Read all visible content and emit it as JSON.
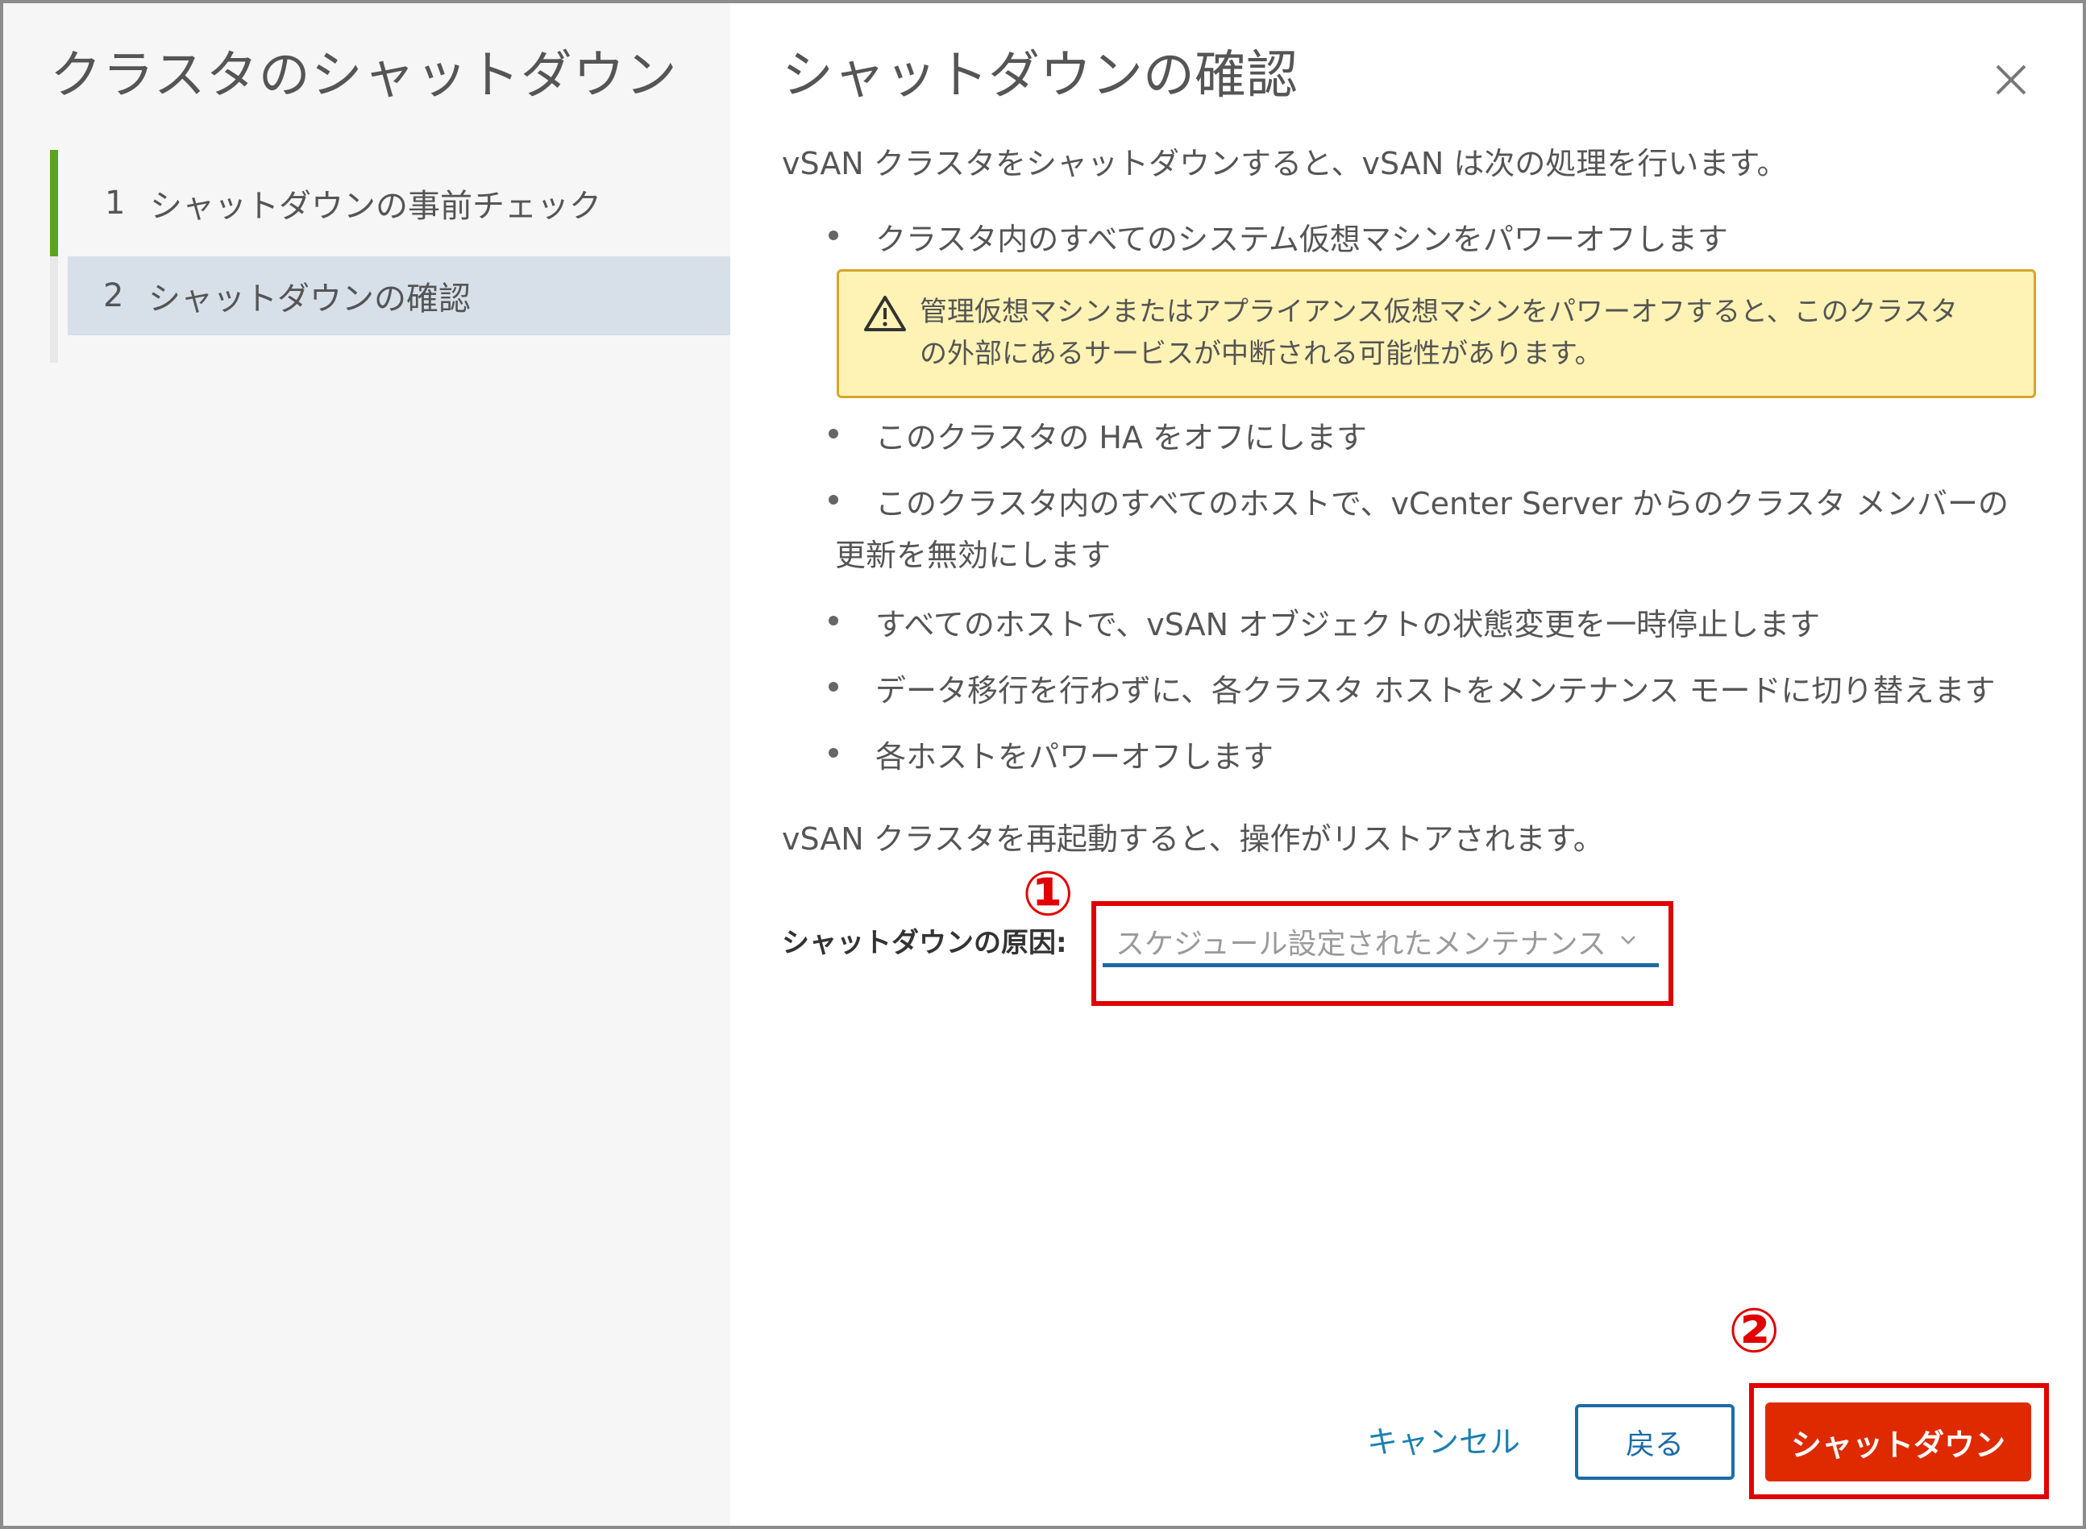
{
  "sidebar": {
    "title": "クラスタのシャットダウン",
    "steps": [
      {
        "num": "1",
        "label": "シャットダウンの事前チェック"
      },
      {
        "num": "2",
        "label": "シャットダウンの確認"
      }
    ]
  },
  "main": {
    "title": "シャットダウンの確認",
    "intro": "vSAN クラスタをシャットダウンすると、vSAN は次の処理を行います。",
    "bullets": [
      "クラスタ内のすべてのシステム仮想マシンをパワーオフします",
      "このクラスタの HA をオフにします",
      "このクラスタ内のすべてのホストで、vCenter Server からのクラスタ メンバーの",
      "すべてのホストで、vSAN オブジェクトの状態変更を一時停止します",
      "データ移行を行わずに、各クラスタ ホストをメンテナンス モードに切り替えます",
      "各ホストをパワーオフします"
    ],
    "bullet3_continuation": "更新を無効にします",
    "warning": "管理仮想マシンまたはアプライアンス仮想マシンをパワーオフすると、このクラスタの外部にあるサービスが中断される可能性があります。",
    "restart_note": "vSAN クラスタを再起動すると、操作がリストアされます。",
    "reason_label": "シャットダウンの原因:",
    "reason_value": "スケジュール設定されたメンテナンス"
  },
  "annotations": {
    "callout1": "①",
    "callout2": "②"
  },
  "footer": {
    "cancel": "キャンセル",
    "back": "戻る",
    "shutdown": "シャットダウン"
  },
  "colors": {
    "accent_green": "#5aa220",
    "primary_blue": "#1b6ca8",
    "danger": "#df2a00",
    "warning_bg": "#fef3b5",
    "callout_red": "#e00000"
  }
}
